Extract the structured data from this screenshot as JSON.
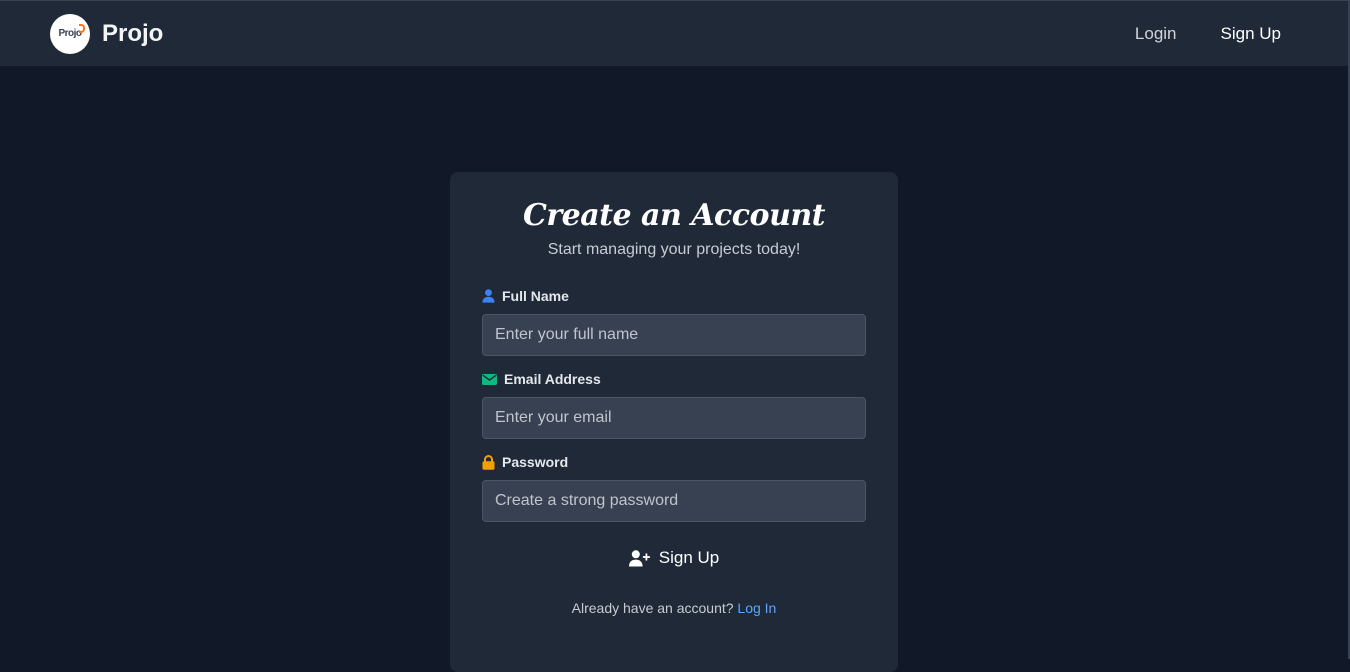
{
  "navbar": {
    "logo_text": "Projo",
    "brand_name": "Projo",
    "login_label": "Login",
    "signup_label": "Sign Up"
  },
  "form": {
    "title": "Create an Account",
    "subtitle": "Start managing your projects today!",
    "full_name": {
      "label": "Full Name",
      "placeholder": "Enter your full name",
      "value": "",
      "icon": "user-icon",
      "icon_color": "#3b82f6"
    },
    "email": {
      "label": "Email Address",
      "placeholder": "Enter your email",
      "value": "",
      "icon": "envelope-icon",
      "icon_color": "#10b981"
    },
    "password": {
      "label": "Password",
      "placeholder": "Create a strong password",
      "value": "",
      "icon": "lock-icon",
      "icon_color": "#f59e0b"
    },
    "submit_label": "Sign Up",
    "submit_icon": "user-plus-icon",
    "footer_text": "Already have an account?",
    "footer_link": "Log In"
  },
  "colors": {
    "background": "#111827",
    "card": "#1f2937",
    "input": "#374151",
    "link": "#60a5fa",
    "logo_accent": "#f97316"
  }
}
